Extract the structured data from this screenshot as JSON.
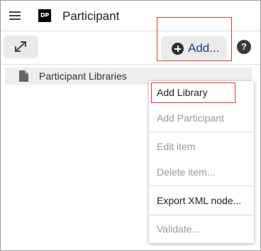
{
  "header": {
    "logo_text": "DP",
    "title": "Participant",
    "menu_icon": "hamburger-icon"
  },
  "toolbar": {
    "expand_icon": "expand-arrows-icon",
    "add_label": "Add...",
    "add_icon": "plus-circle-icon",
    "help_label": "?"
  },
  "tree": {
    "root_label": "Participant Libraries",
    "root_icon": "document-icon"
  },
  "menu": {
    "items": [
      {
        "label": "Add Library",
        "enabled": true
      },
      {
        "label": "Add Participant",
        "enabled": false
      },
      {
        "label": "Edit item",
        "enabled": false
      },
      {
        "label": "Delete item...",
        "enabled": false
      },
      {
        "label": "Export XML node...",
        "enabled": true
      },
      {
        "label": "Validate...",
        "enabled": false
      }
    ]
  },
  "colors": {
    "accent_text": "#1f3e8a",
    "highlight_border": "#e03c3c",
    "disabled_text": "#9a9a9a"
  }
}
